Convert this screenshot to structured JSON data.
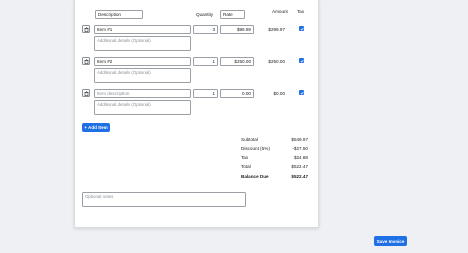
{
  "table": {
    "headers": {
      "description": "Description",
      "quantity": "Quantity",
      "rate": "Rate",
      "amount": "Amount",
      "tax": "Tax"
    },
    "rows": [
      {
        "description": "Item #1",
        "details_placeholder": "Additional details (Optional)",
        "quantity": "3",
        "rate": "$99.99",
        "amount": "$299.97",
        "taxed": true
      },
      {
        "description": "Item #2",
        "details_placeholder": "Additional details (Optional)",
        "quantity": "1",
        "rate": "$250.00",
        "amount": "$250.00",
        "taxed": true
      },
      {
        "description": "",
        "description_placeholder": "Item description",
        "details_placeholder": "Additional details (Optional)",
        "quantity": "1",
        "rate": "0.00",
        "amount": "$0.00",
        "taxed": true
      }
    ]
  },
  "add_item_label": "+ Add Item",
  "totals": {
    "subtotal_label": "Subtotal",
    "subtotal_value": "$549.97",
    "discount_label": "Discount (5%)",
    "discount_value": "-$27.50",
    "tax_label": "Tax",
    "tax_value": "$24.88",
    "total_label": "Total",
    "total_value": "$522.47",
    "balance_label": "Balance Due",
    "balance_value": "$522.47"
  },
  "notes_placeholder": "Optional notes",
  "save_label": "Save Invoice",
  "colors": {
    "accent": "#1f6fe5",
    "background": "#eef0f3",
    "card": "#ffffff"
  },
  "icons": {
    "delete": "trash-icon",
    "tax_checked": "checkbox-checked-icon"
  }
}
